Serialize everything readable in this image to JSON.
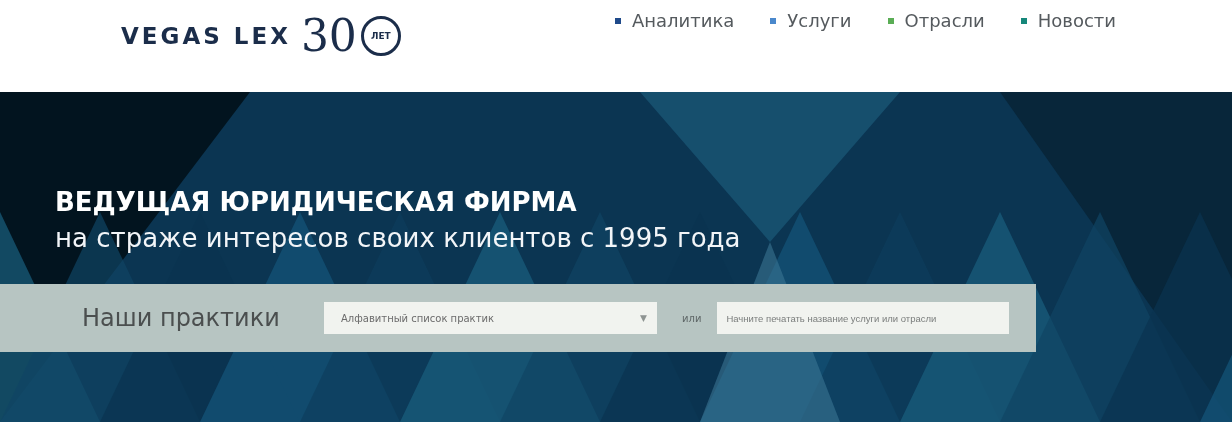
{
  "logo": {
    "name": "VEGAS LEX",
    "years": "30",
    "years_label": "ЛЕТ"
  },
  "nav": [
    {
      "label": "Аналитика",
      "color": "#1f4a8a"
    },
    {
      "label": "Услуги",
      "color": "#4a88cc"
    },
    {
      "label": "Отрасли",
      "color": "#5aad55"
    },
    {
      "label": "Новости",
      "color": "#16877a"
    }
  ],
  "hero": {
    "title": "ВЕДУЩАЯ ЮРИДИЧЕСКАЯ ФИРМА",
    "subtitle": "на страже интересов своих клиентов с 1995 года"
  },
  "practices": {
    "label": "Наши практики",
    "dropdown": {
      "value": "Алфавитный список практик",
      "arrow": "▼"
    },
    "separator": "или",
    "search": {
      "placeholder": "Начните печатать название услуги или отрасли"
    }
  }
}
